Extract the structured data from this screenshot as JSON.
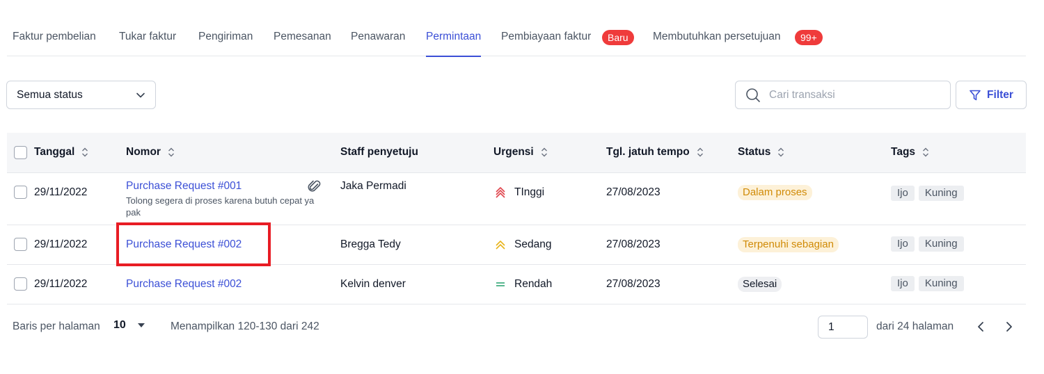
{
  "tabs": [
    {
      "label": "Faktur pembelian"
    },
    {
      "label": "Tukar faktur"
    },
    {
      "label": "Pengiriman"
    },
    {
      "label": "Pemesanan"
    },
    {
      "label": "Penawaran"
    },
    {
      "label": "Permintaan",
      "active": true
    },
    {
      "label": "Pembiayaan faktur",
      "badge": "Baru"
    },
    {
      "label": "Membutuhkan persetujuan",
      "badge": "99+"
    }
  ],
  "toolbar": {
    "status_select": "Semua status",
    "search_placeholder": "Cari transaksi",
    "filter_label": "Filter"
  },
  "table": {
    "headers": {
      "tanggal": "Tanggal",
      "nomor": "Nomor",
      "staff": "Staff penyetuju",
      "urgensi": "Urgensi",
      "jatuh_tempo": "Tgl. jatuh tempo",
      "status": "Status",
      "tags": "Tags"
    },
    "rows": [
      {
        "tanggal": "29/11/2022",
        "nomor": "Purchase Request #001",
        "note": "Tolong segera di proses karena butuh cepat ya pak",
        "staff": "Jaka Permadi",
        "urgensi": "TInggi",
        "jatuh_tempo": "27/08/2023",
        "status": "Dalam proses",
        "tags": [
          "Ijo",
          "Kuning"
        ]
      },
      {
        "tanggal": "29/11/2022",
        "nomor": "Purchase Request #002",
        "staff": "Bregga Tedy",
        "urgensi": "Sedang",
        "jatuh_tempo": "27/08/2023",
        "status": "Terpenuhi sebagian",
        "tags": [
          "Ijo",
          "Kuning"
        ]
      },
      {
        "tanggal": "29/11/2022",
        "nomor": "Purchase Request #002",
        "staff": "Kelvin denver",
        "urgensi": "Rendah",
        "jatuh_tempo": "27/08/2023",
        "status": "Selesai",
        "tags": [
          "Ijo",
          "Kuning"
        ]
      }
    ]
  },
  "footer": {
    "rows_per_page_label": "Baris per halaman",
    "rows_per_page_value": "10",
    "showing": "Menampilkan 120-130 dari 242",
    "page_value": "1",
    "page_total": "dari 24 halaman"
  },
  "colors": {
    "accent": "#3b4fd6",
    "badge": "#ef3b3b",
    "urgent_high": "#e0454d",
    "urgent_medium": "#e8b41c",
    "urgent_low": "#22a06b",
    "highlight": "#e81c24"
  }
}
